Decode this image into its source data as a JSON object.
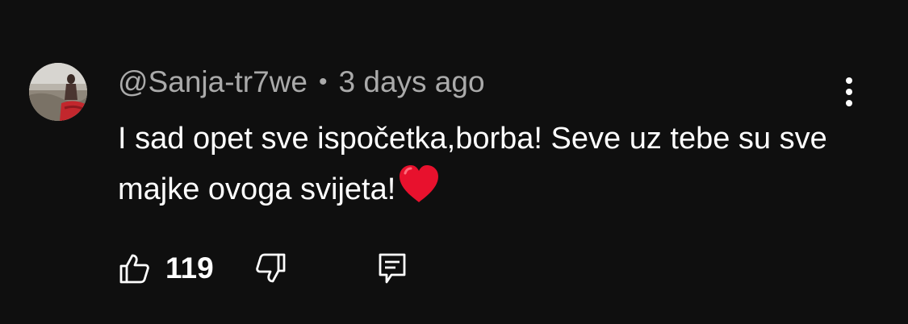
{
  "comment": {
    "author": "@Sanja-tr7we",
    "separator": "•",
    "timestamp": "3 days ago",
    "text": "I sad opet sve ispočetka,borba! Seve uz tebe su sve majke ovoga svijeta!",
    "emoji": "red-heart",
    "likes": "119",
    "icons": {
      "like": "thumbs-up-icon",
      "dislike": "thumbs-down-icon",
      "reply": "reply-comment-icon",
      "more": "more-vertical-icon"
    }
  },
  "colors": {
    "background": "#0f0f0f",
    "text_primary": "#ffffff",
    "text_secondary": "#aaaaaa",
    "heart": "#e8112d"
  }
}
